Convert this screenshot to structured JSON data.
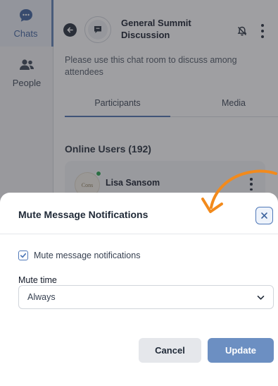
{
  "sidebar": {
    "items": [
      {
        "label": "Chats",
        "icon": "chat-bubble-icon",
        "active": true
      },
      {
        "label": "People",
        "icon": "people-icon",
        "active": false
      }
    ]
  },
  "header": {
    "room_title": "General Summit Discussion",
    "room_icon": "chat-room-icon",
    "mute_icon": "bell-muted-icon"
  },
  "room": {
    "description": "Please use this chat room to discuss among attendees"
  },
  "tabs": [
    {
      "label": "Participants",
      "active": true
    },
    {
      "label": "Media",
      "active": false
    }
  ],
  "participants": {
    "online_title": "Online Users (192)",
    "users": [
      {
        "name": "Lisa Sansom",
        "online": true,
        "avatar_text": "Cons"
      }
    ]
  },
  "modal": {
    "title": "Mute Message Notifications",
    "checkbox_label": "Mute message notifications",
    "checkbox_checked": true,
    "mute_time_label": "Mute time",
    "mute_time_value": "Always",
    "cancel_label": "Cancel",
    "update_label": "Update"
  },
  "colors": {
    "accent": "#4f78b8",
    "update_button": "#6c8fc2",
    "annotation_arrow": "#f28a1c",
    "online": "#22a24a"
  }
}
